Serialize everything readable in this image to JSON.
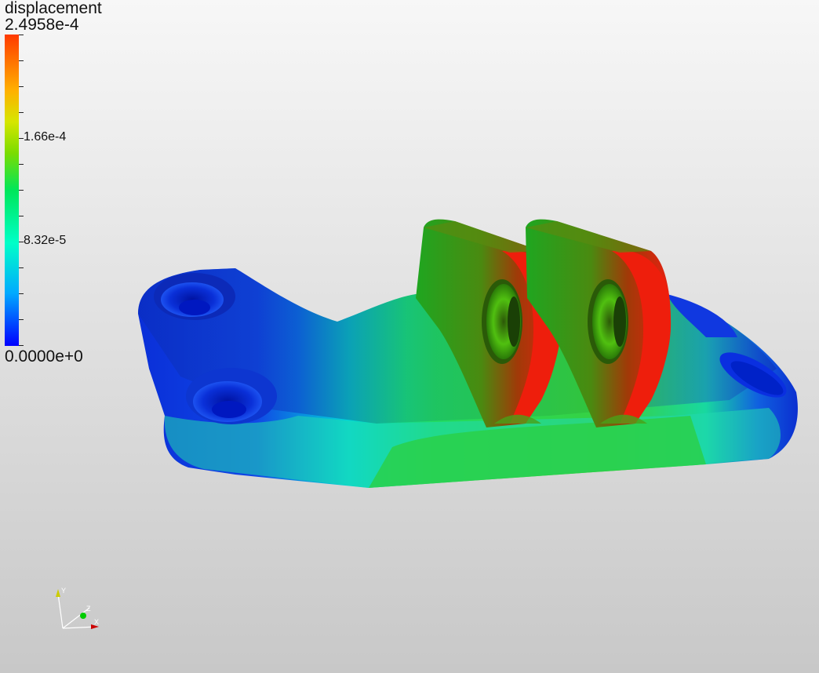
{
  "legend": {
    "title": "displacement",
    "max_label": "2.4958e-4",
    "min_label": "0.0000e+0",
    "ticks": [
      "1.66e-4",
      "8.32e-5"
    ],
    "colormap": [
      "#0000ff",
      "#00aaff",
      "#00ffc8",
      "#00e65a",
      "#7bdc00",
      "#d6e600",
      "#ffb000",
      "#ff3a00"
    ]
  },
  "axes": {
    "labels": [
      "Y",
      "Z",
      "X"
    ],
    "colors": {
      "x": "#cc0000",
      "y": "#cccc00",
      "z": "#00cc00"
    }
  },
  "icons": [
    "orientation-axes-icon"
  ]
}
